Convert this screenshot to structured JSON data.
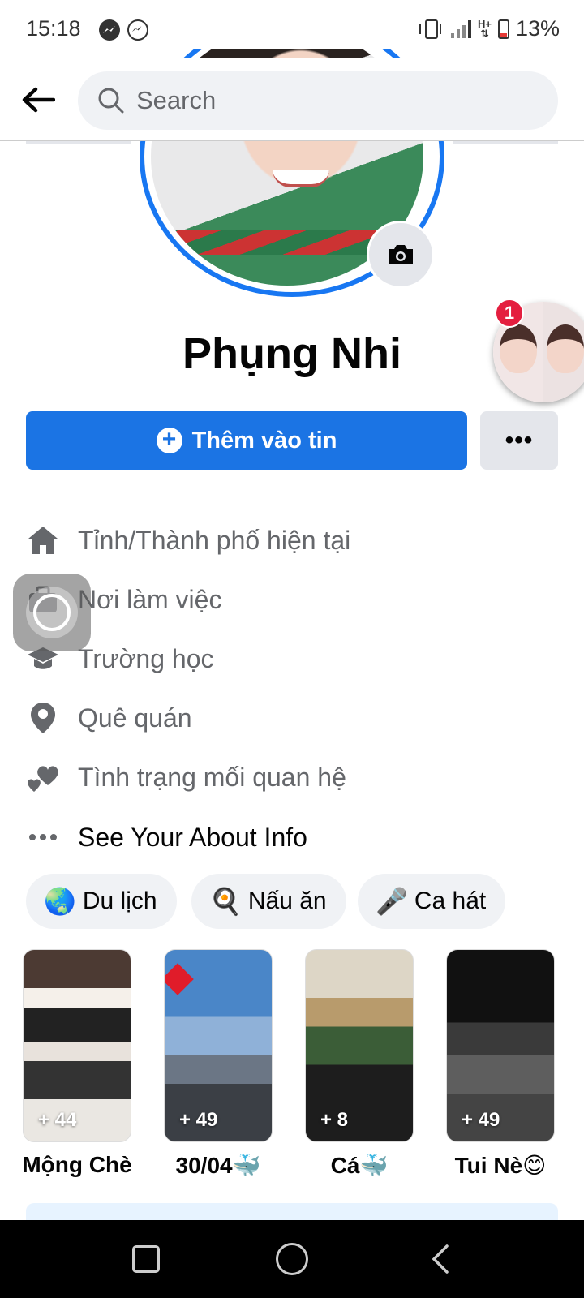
{
  "status_bar": {
    "time": "15:18",
    "battery": "13%",
    "network_type": "H+",
    "icons": [
      "messenger-icon",
      "messenger-outline-icon",
      "vibrate-icon",
      "signal-icon",
      "battery-icon"
    ]
  },
  "top_bar": {
    "search_placeholder": "Search"
  },
  "profile": {
    "name": "Phụng Nhi",
    "add_story_label": "Thêm vào tin",
    "more_label": "•••",
    "chat_head_badge": "1"
  },
  "info": {
    "items": [
      {
        "icon": "home-icon",
        "label": "Tỉnh/Thành phố hiện tại"
      },
      {
        "icon": "briefcase-icon",
        "label": "Nơi làm việc"
      },
      {
        "icon": "graduation-cap-icon",
        "label": "Trường học"
      },
      {
        "icon": "location-pin-icon",
        "label": "Quê quán"
      },
      {
        "icon": "hearts-icon",
        "label": "Tình trạng mối quan hệ"
      },
      {
        "icon": "more-dots-icon",
        "label": "See Your About Info"
      }
    ]
  },
  "hobbies": [
    {
      "emoji": "🌏",
      "label": "Du lịch"
    },
    {
      "emoji": "🍳",
      "label": "Nấu ăn"
    },
    {
      "emoji": "🎤",
      "label": "Ca hát"
    }
  ],
  "highlights": [
    {
      "count": "+ 44",
      "title": "Mộng Chè"
    },
    {
      "count": "+ 49",
      "title": "30/04🐳"
    },
    {
      "count": "+ 8",
      "title": "Cá🐳"
    },
    {
      "count": "+ 49",
      "title": "Tui Nè😊"
    }
  ],
  "colors": {
    "accent": "#1b74e4",
    "avatar_ring": "#1877f2",
    "badge": "#e41e3f",
    "secondary_text": "#65676b",
    "chip_bg": "#f0f2f5"
  }
}
